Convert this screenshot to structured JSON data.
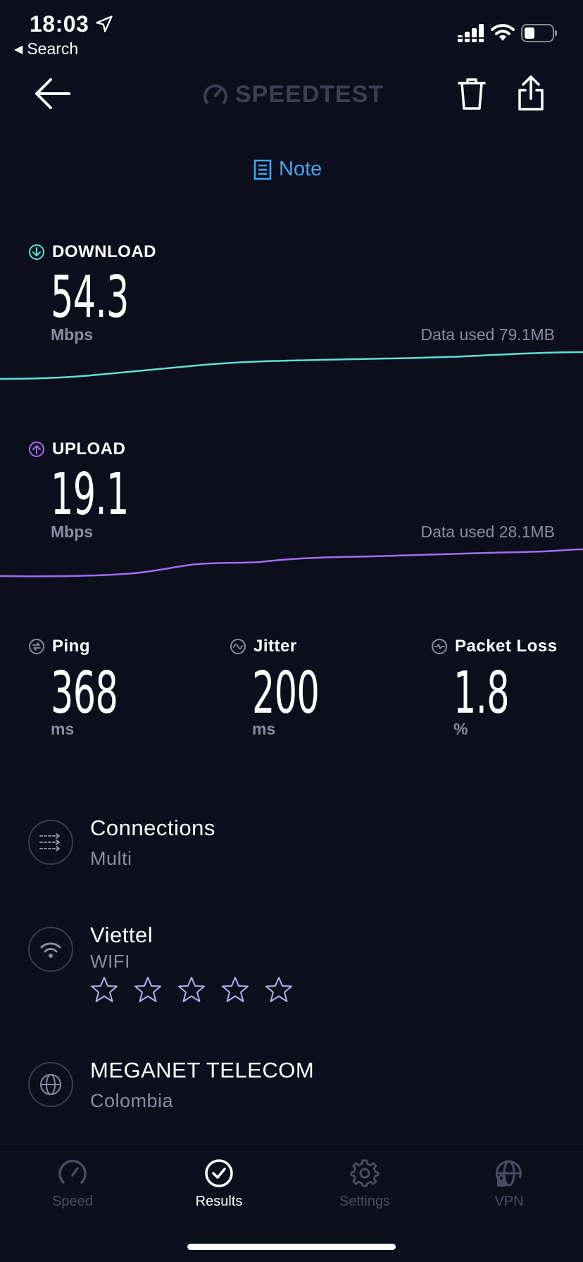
{
  "status_bar": {
    "time": "18:03",
    "back_app": "Search"
  },
  "toolbar": {
    "logo": "SPEEDTEST"
  },
  "note_label": "Note",
  "download": {
    "label": "DOWNLOAD",
    "value": "54.3",
    "unit": "Mbps",
    "data_used": "Data used 79.1MB",
    "color": "#5fe0d6"
  },
  "upload": {
    "label": "UPLOAD",
    "value": "19.1",
    "unit": "Mbps",
    "data_used": "Data used 28.1MB",
    "color": "#a06ef0"
  },
  "ping": {
    "label": "Ping",
    "value": "368",
    "unit": "ms"
  },
  "jitter": {
    "label": "Jitter",
    "value": "200",
    "unit": "ms"
  },
  "packet_loss": {
    "label": "Packet Loss",
    "value": "1.8",
    "unit": "%"
  },
  "details": {
    "connections": {
      "title": "Connections",
      "sub": "Multi"
    },
    "network": {
      "title": "Viettel",
      "sub": "WIFI",
      "rating": 0,
      "rating_max": 5
    },
    "server": {
      "title": "MEGANET TELECOM",
      "sub": "Colombia"
    }
  },
  "tabs": [
    {
      "label": "Speed",
      "icon": "speedometer-icon",
      "active": false
    },
    {
      "label": "Results",
      "icon": "check-circle-icon",
      "active": true
    },
    {
      "label": "Settings",
      "icon": "gear-icon",
      "active": false
    },
    {
      "label": "VPN",
      "icon": "globe-lock-icon",
      "active": false
    }
  ]
}
